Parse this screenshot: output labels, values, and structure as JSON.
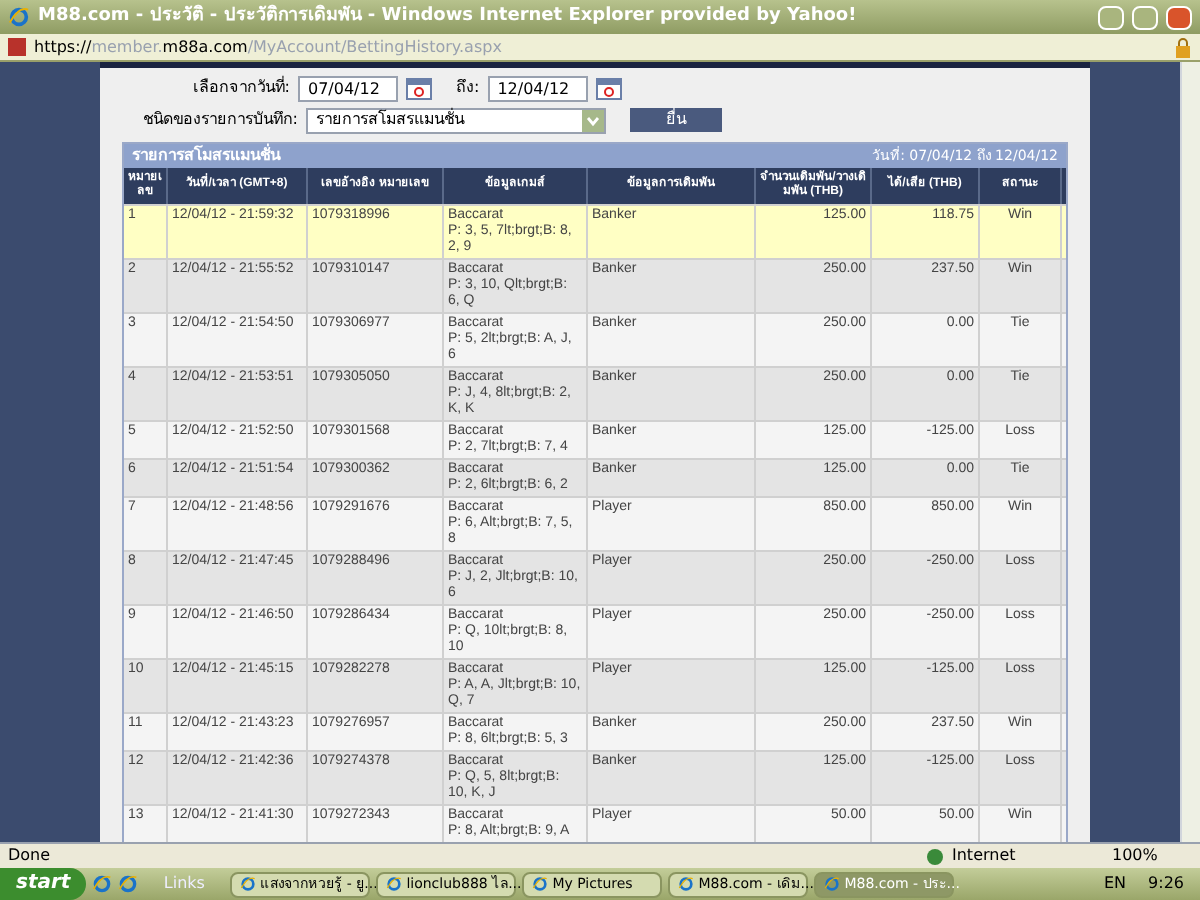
{
  "window": {
    "title": "M88.com - ประวัติ - ประวัติการเดิมพัน - Windows Internet Explorer provided by Yahoo!"
  },
  "address_bar": {
    "scheme": "https://",
    "host": "member.m88a.com",
    "path": "/MyAccount/BettingHistory.aspx"
  },
  "filter": {
    "from_label": "เลือกจากวันที่:",
    "from_value": "07/04/12",
    "to_label": "ถึง:",
    "to_value": "12/04/12",
    "type_label": "ชนิดของรายการบันทึก:",
    "type_value": "รายการสโมสรแมนชั่น",
    "submit": "ยื่น"
  },
  "table": {
    "title": "รายการสโมสรแมนชั่น",
    "range": "วันที่: 07/04/12 ถึง 12/04/12",
    "columns": [
      "หมายเลข",
      "วันที่/เวลา (GMT+8)",
      "เลขอ้างอิง หมายเลข",
      "ข้อมูลเกมส์",
      "ข้อมูลการเดิมพัน",
      "จำนวนเดิมพัน/วางเดิมพัน (THB)",
      "ได้/เสีย (THB)",
      "สถานะ"
    ],
    "rows": [
      {
        "no": "1",
        "time": "12/04/12 - 21:59:32",
        "ref": "1079318996",
        "game": "Baccarat",
        "detail": "P: 3, 5, 7lt;brgt;B: 8, 2, 9",
        "bet": "Banker",
        "amount": "125.00",
        "result": "118.75",
        "status": "Win",
        "selected": true
      },
      {
        "no": "2",
        "time": "12/04/12 - 21:55:52",
        "ref": "1079310147",
        "game": "Baccarat",
        "detail": "P: 3, 10, Qlt;brgt;B: 6, Q",
        "bet": "Banker",
        "amount": "250.00",
        "result": "237.50",
        "status": "Win",
        "selected": false
      },
      {
        "no": "3",
        "time": "12/04/12 - 21:54:50",
        "ref": "1079306977",
        "game": "Baccarat",
        "detail": "P: 5, 2lt;brgt;B: A, J, 6",
        "bet": "Banker",
        "amount": "250.00",
        "result": "0.00",
        "status": "Tie",
        "selected": false
      },
      {
        "no": "4",
        "time": "12/04/12 - 21:53:51",
        "ref": "1079305050",
        "game": "Baccarat",
        "detail": "P: J, 4, 8lt;brgt;B: 2, K, K",
        "bet": "Banker",
        "amount": "250.00",
        "result": "0.00",
        "status": "Tie",
        "selected": false
      },
      {
        "no": "5",
        "time": "12/04/12 - 21:52:50",
        "ref": "1079301568",
        "game": "Baccarat",
        "detail": "P: 2, 7lt;brgt;B: 7, 4",
        "bet": "Banker",
        "amount": "125.00",
        "result": "-125.00",
        "status": "Loss",
        "selected": false
      },
      {
        "no": "6",
        "time": "12/04/12 - 21:51:54",
        "ref": "1079300362",
        "game": "Baccarat",
        "detail": "P: 2, 6lt;brgt;B: 6, 2",
        "bet": "Banker",
        "amount": "125.00",
        "result": "0.00",
        "status": "Tie",
        "selected": false
      },
      {
        "no": "7",
        "time": "12/04/12 - 21:48:56",
        "ref": "1079291676",
        "game": "Baccarat",
        "detail": "P: 6, Alt;brgt;B: 7, 5, 8",
        "bet": "Player",
        "amount": "850.00",
        "result": "850.00",
        "status": "Win",
        "selected": false
      },
      {
        "no": "8",
        "time": "12/04/12 - 21:47:45",
        "ref": "1079288496",
        "game": "Baccarat",
        "detail": "P: J, 2, Jlt;brgt;B: 10, 6",
        "bet": "Player",
        "amount": "250.00",
        "result": "-250.00",
        "status": "Loss",
        "selected": false
      },
      {
        "no": "9",
        "time": "12/04/12 - 21:46:50",
        "ref": "1079286434",
        "game": "Baccarat",
        "detail": "P: Q, 10lt;brgt;B: 8, 10",
        "bet": "Player",
        "amount": "250.00",
        "result": "-250.00",
        "status": "Loss",
        "selected": false
      },
      {
        "no": "10",
        "time": "12/04/12 - 21:45:15",
        "ref": "1079282278",
        "game": "Baccarat",
        "detail": "P: A, A, Jlt;brgt;B: 10, Q, 7",
        "bet": "Player",
        "amount": "125.00",
        "result": "-125.00",
        "status": "Loss",
        "selected": false
      },
      {
        "no": "11",
        "time": "12/04/12 - 21:43:23",
        "ref": "1079276957",
        "game": "Baccarat",
        "detail": "P: 8, 6lt;brgt;B: 5, 3",
        "bet": "Banker",
        "amount": "250.00",
        "result": "237.50",
        "status": "Win",
        "selected": false
      },
      {
        "no": "12",
        "time": "12/04/12 - 21:42:36",
        "ref": "1079274378",
        "game": "Baccarat",
        "detail": "P: Q, 5, 8lt;brgt;B: 10, K, J",
        "bet": "Banker",
        "amount": "125.00",
        "result": "-125.00",
        "status": "Loss",
        "selected": false
      },
      {
        "no": "13",
        "time": "12/04/12 - 21:41:30",
        "ref": "1079272343",
        "game": "Baccarat",
        "detail": "P: 8, Alt;brgt;B: 9, A",
        "bet": "Player",
        "amount": "50.00",
        "result": "50.00",
        "status": "Win",
        "selected": false
      }
    ]
  },
  "status_bar": {
    "text": "Done",
    "zone": "Internet",
    "zoom": "100%"
  },
  "taskbar": {
    "start": "start",
    "links": "Links",
    "tasks": [
      {
        "label": "แสงจากหวยรู้ - ยู...",
        "selected": false
      },
      {
        "label": "lionclub888 ไล...",
        "selected": false
      },
      {
        "label": "My Pictures",
        "selected": false
      },
      {
        "label": "M88.com - เดิม...",
        "selected": false
      },
      {
        "label": "M88.com - ประ...",
        "selected": true
      }
    ],
    "language": "EN",
    "clock": "9:26"
  }
}
